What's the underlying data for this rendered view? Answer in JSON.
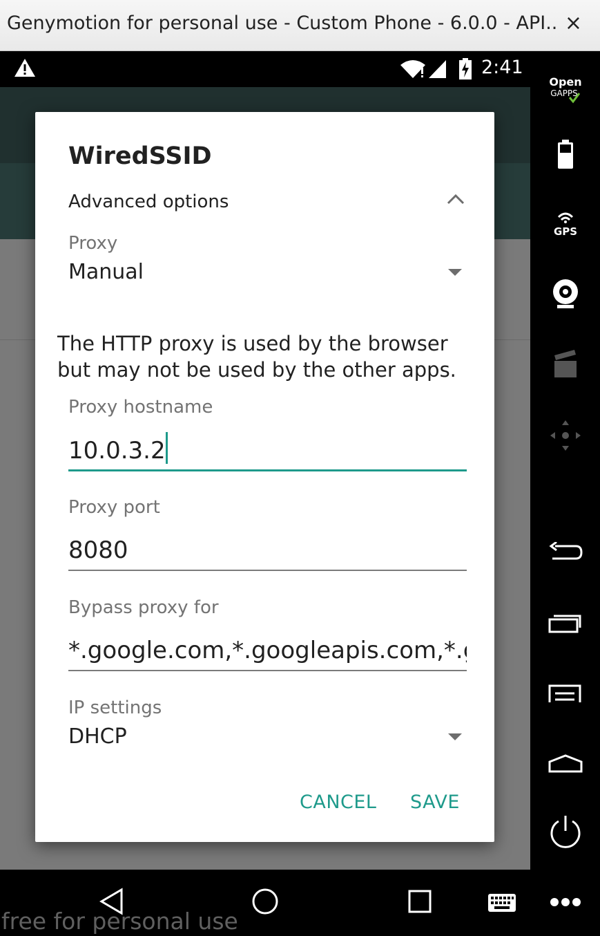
{
  "window": {
    "title": "Genymotion for personal use - Custom Phone - 6.0.0 - API...",
    "close": "×"
  },
  "status_bar": {
    "time": "2:41"
  },
  "dialog": {
    "title": "WiredSSID",
    "advanced_options": "Advanced options",
    "proxy_label": "Proxy",
    "proxy_value": "Manual",
    "help_text": "The HTTP proxy is used by the browser but may not be used by the other apps.",
    "hostname_label": "Proxy hostname",
    "hostname_value": "10.0.3.2",
    "port_label": "Proxy port",
    "port_value": "8080",
    "bypass_label": "Bypass proxy for",
    "bypass_value": "*.google.com,*.googleapis.com,*.gstatic.com",
    "ip_label": "IP settings",
    "ip_value": "DHCP",
    "cancel": "CANCEL",
    "save": "SAVE"
  },
  "sidebar": {
    "gapps_line1": "Open",
    "gapps_line2": "GAPPS",
    "gps": "GPS"
  },
  "watermark": "free for personal use",
  "colors": {
    "accent": "#1e9a8b",
    "appbar": "#20302f",
    "scrim": "#7a7a7a"
  }
}
